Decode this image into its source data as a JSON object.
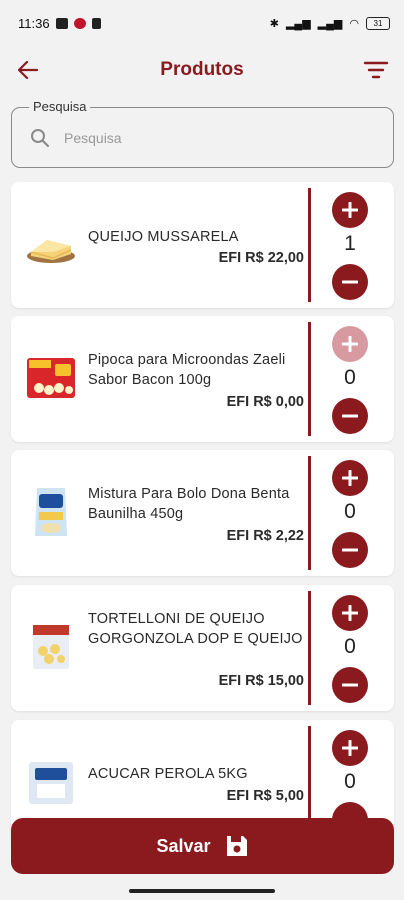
{
  "status_bar": {
    "time": "11:36",
    "icons": [
      "youtube-icon",
      "no-entry-icon",
      "trash-icon",
      "bluetooth-icon",
      "signal-icon",
      "signal-icon",
      "wifi-icon",
      "battery-icon"
    ],
    "battery": "31",
    "colors": {
      "notification_red": "#c0142a"
    }
  },
  "header": {
    "title": "Produtos",
    "back_icon": "arrow-left-icon",
    "filter_icon": "filter-icon"
  },
  "search": {
    "label": "Pesquisa",
    "placeholder": "Pesquisa",
    "value": ""
  },
  "products": [
    {
      "name": "QUEIJO MUSSARELA",
      "price": "EFI R$ 22,00",
      "quantity": "1",
      "plus_disabled": false,
      "image": "cheese-block-image"
    },
    {
      "name": "Pipoca para Microondas Zaeli Sabor Bacon 100g",
      "price": "EFI R$ 0,00",
      "quantity": "0",
      "plus_disabled": true,
      "image": "popcorn-package-image"
    },
    {
      "name": "Mistura Para Bolo Dona Benta Baunilha 450g",
      "price": "EFI R$ 2,22",
      "quantity": "0",
      "plus_disabled": false,
      "image": "cake-mix-package-image"
    },
    {
      "name": "TORTELLONI DE QUEIJO GORGONZOLA DOP E QUEIJO",
      "price": "EFI R$ 15,00",
      "quantity": "0",
      "plus_disabled": false,
      "image": "tortelloni-package-image"
    },
    {
      "name": "ACUCAR PEROLA 5KG",
      "price": "EFI R$ 5,00",
      "quantity": "0",
      "plus_disabled": false,
      "image": "sugar-bag-image"
    }
  ],
  "footer": {
    "save_label": "Salvar",
    "save_icon": "floppy-disk-icon"
  },
  "colors": {
    "accent": "#8b1a1f",
    "accent_disabled": "#d79aa0",
    "background": "#f2f2f2"
  }
}
